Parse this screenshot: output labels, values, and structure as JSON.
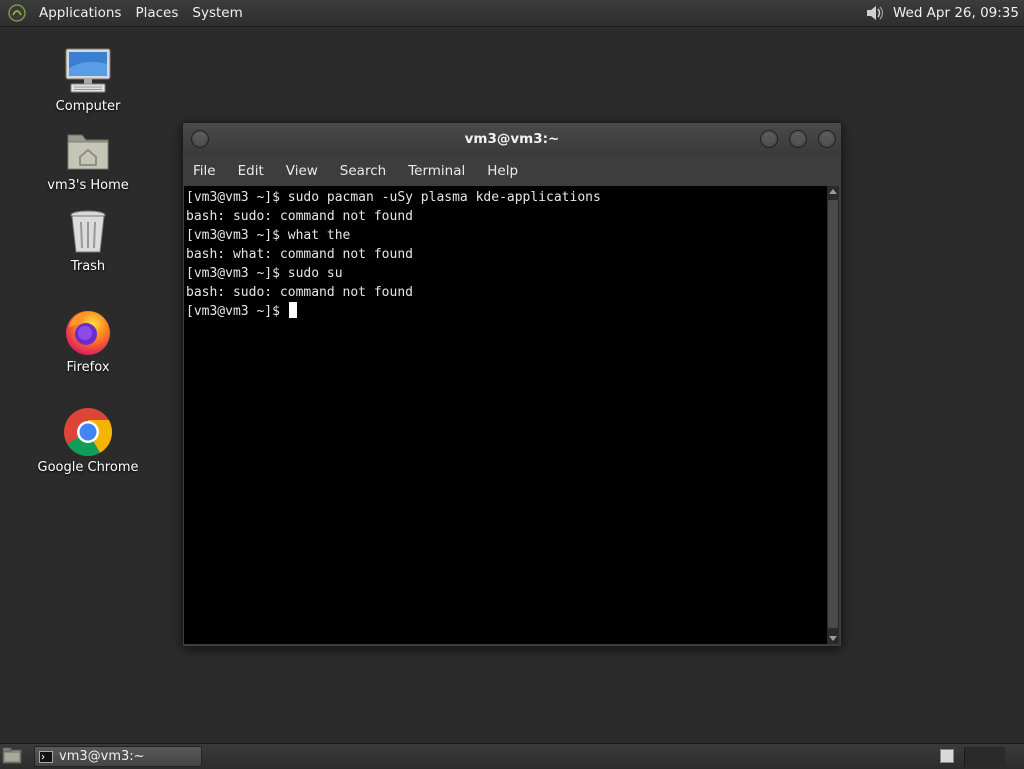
{
  "top_panel": {
    "menus": [
      "Applications",
      "Places",
      "System"
    ],
    "clock": "Wed Apr 26, 09:35",
    "icons": [
      "menu-logo-icon",
      "speaker-icon"
    ]
  },
  "desktop_icons": [
    {
      "label": "Computer",
      "icon": "computer-icon"
    },
    {
      "label": "vm3's Home",
      "icon": "home-folder-icon"
    },
    {
      "label": "Trash",
      "icon": "trash-icon"
    },
    {
      "label": "Firefox",
      "icon": "firefox-icon"
    },
    {
      "label": "Google Chrome",
      "icon": "chrome-icon"
    }
  ],
  "terminal_window": {
    "title": "vm3@vm3:~",
    "menu": [
      "File",
      "Edit",
      "View",
      "Search",
      "Terminal",
      "Help"
    ],
    "lines": [
      "[vm3@vm3 ~]$ sudo pacman -uSy plasma kde-applications",
      "bash: sudo: command not found",
      "[vm3@vm3 ~]$ what the",
      "bash: what: command not found",
      "[vm3@vm3 ~]$ sudo su",
      "bash: sudo: command not found"
    ],
    "prompt": "[vm3@vm3 ~]$ "
  },
  "taskbar": {
    "task_label": "vm3@vm3:~"
  },
  "colors": {
    "desktop_bg": "#2b2b2b",
    "terminal_bg": "#000000",
    "terminal_fg": "#e6e6e6"
  }
}
